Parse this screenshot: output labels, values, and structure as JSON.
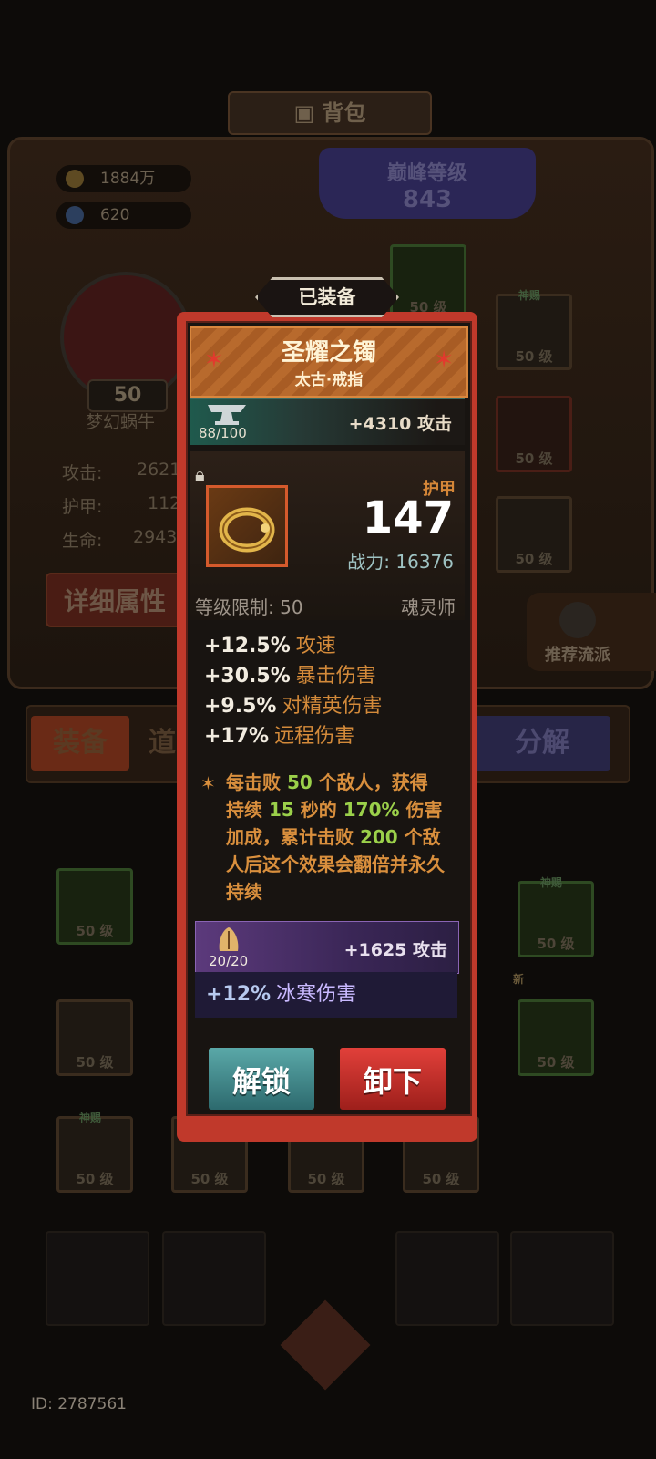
{
  "header": {
    "title": "背包"
  },
  "currency": {
    "gold": "1884万",
    "gems": "620"
  },
  "peak": {
    "label": "巅峰等级",
    "value": "843"
  },
  "player": {
    "level": "50",
    "name": "梦幻蜗牛",
    "stats": [
      {
        "label": "攻击:",
        "value": "2621"
      },
      {
        "label": "护甲:",
        "value": "112"
      },
      {
        "label": "生命:",
        "value": "2943"
      }
    ],
    "detail_button": "详细属性"
  },
  "recommend": "推荐流派",
  "tabs": [
    "装备",
    "道",
    "分解"
  ],
  "slot_level": "50 级",
  "slot_tag": "神赐",
  "new_tag": "新",
  "user_id": "ID: 2787561",
  "popup": {
    "equipped_label": "已装备",
    "item_name": "圣耀之镯",
    "item_sub": "太古·戒指",
    "forge": {
      "count": "88/100",
      "bonus": "+4310 攻击"
    },
    "armor_label": "护甲",
    "armor_value": "147",
    "power": "战力: 16376",
    "level_req": "等级限制: 50",
    "class": "魂灵师",
    "stats": [
      {
        "value": "+12.5%",
        "name": "攻速"
      },
      {
        "value": "+30.5%",
        "name": "暴击伤害"
      },
      {
        "value": "+9.5%",
        "name": "对精英伤害"
      },
      {
        "value": "+17%",
        "name": "远程伤害"
      }
    ],
    "special": {
      "p1": "每击败 ",
      "n1": "50",
      "p2": " 个敌人，获得持续 ",
      "n2": "15",
      "p3": " 秒的 ",
      "n3": "170%",
      "p4": " 伤害加成，累计击败 ",
      "n4": "200",
      "p5": " 个敌人后这个效果会翻倍并永久持续"
    },
    "gem": {
      "count": "20/20",
      "bonus": "+1625 攻击",
      "stat_value": "+12%",
      "stat_name": "冰寒伤害"
    },
    "buttons": {
      "unlock": "解锁",
      "unequip": "卸下"
    }
  },
  "colors": {
    "frame": "#c0392b",
    "accent": "#d38a3a",
    "highlight": "#9bd04a",
    "unlock": "#3f8b8e",
    "unequip": "#c42f29"
  }
}
